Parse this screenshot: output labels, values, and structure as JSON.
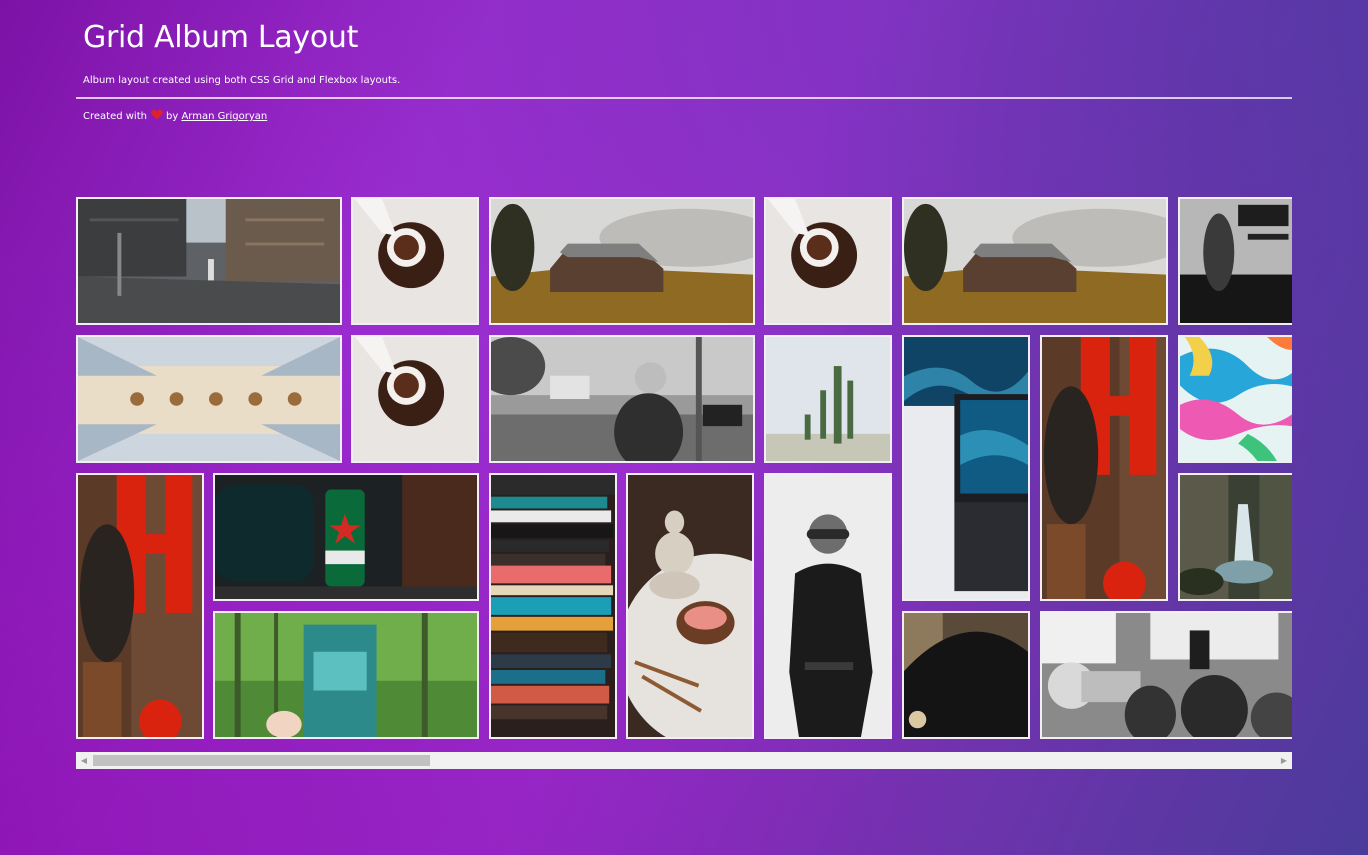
{
  "header": {
    "title": "Grid Album Layout",
    "subtitle": "Album layout created using both CSS Grid and Flexbox layouts.",
    "credit_prefix": "Created with",
    "credit_by": "by",
    "author_link": "Arman Grigoryan"
  },
  "colors": {
    "background_start": "#7d12a6",
    "background_mid": "#9b2fd0",
    "background_end": "#4a3b9a",
    "tile_border": "#f3eef5",
    "heart": "#e0212b"
  },
  "gallery": {
    "photos": [
      {
        "name": "photo-city-street",
        "subject": "rainy city street"
      },
      {
        "name": "photo-coffee-pour",
        "subject": "coffee pour"
      },
      {
        "name": "photo-farmhouse",
        "subject": "barn in misty field"
      },
      {
        "name": "photo-coffee-pour",
        "subject": "coffee pour"
      },
      {
        "name": "photo-farmhouse",
        "subject": "barn in misty field"
      },
      {
        "name": "photo-subway",
        "subject": "subway station 14th"
      },
      {
        "name": "photo-cathedral-ceiling",
        "subject": "cathedral ceiling"
      },
      {
        "name": "photo-coffee-pour",
        "subject": "coffee pour"
      },
      {
        "name": "photo-street-bw",
        "subject": "black and white street"
      },
      {
        "name": "photo-cactus",
        "subject": "cactus"
      },
      {
        "name": "photo-laptop-ocean",
        "subject": "laptop with ocean"
      },
      {
        "name": "photo-red-neon",
        "subject": "person and red neon"
      },
      {
        "name": "photo-abstract-paint",
        "subject": "colorful abstract paint"
      },
      {
        "name": "photo-red-neon",
        "subject": "person and red neon"
      },
      {
        "name": "photo-heineken-can",
        "subject": "beer can"
      },
      {
        "name": "photo-books",
        "subject": "stack of books"
      },
      {
        "name": "photo-buddha-bowl",
        "subject": "buddha statue and bowl"
      },
      {
        "name": "photo-fashion-bw",
        "subject": "fashion portrait"
      },
      {
        "name": "photo-waterfall",
        "subject": "waterfall"
      },
      {
        "name": "photo-cosmic-frogger",
        "subject": "game box in forest"
      },
      {
        "name": "photo-umbrella",
        "subject": "black umbrella"
      },
      {
        "name": "photo-protest",
        "subject": "protest with megaphone"
      }
    ]
  },
  "scrollbar": {
    "position_fraction": 0
  }
}
